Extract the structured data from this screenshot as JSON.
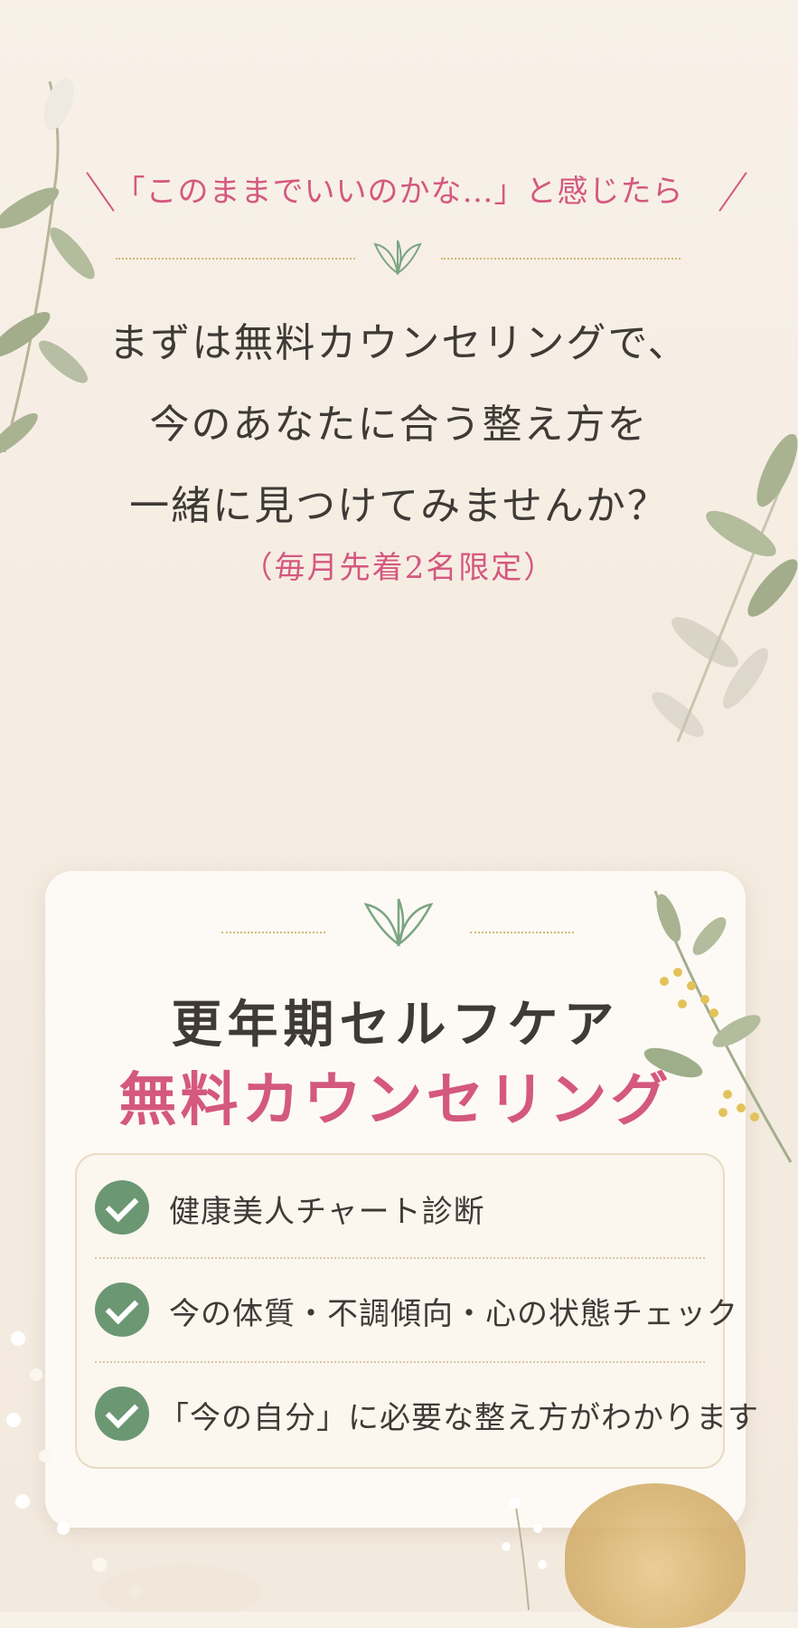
{
  "intro": {
    "lead_text": "「このままでいいのかな…」と感じたら",
    "lines": [
      "まずは無料カウンセリングで、",
      "今のあなたに合う整え方を",
      "一緒に見つけてみませんか？"
    ],
    "limited": "（毎月先着2名限定）"
  },
  "card": {
    "title": "更年期セルフケア",
    "subtitle": "無料カウンセリング",
    "items": [
      {
        "label": "健康美人チャート診断",
        "icon": "check-icon"
      },
      {
        "label": "今の体質・不調傾向・心の状態チェック",
        "icon": "check-icon"
      },
      {
        "label": "「今の自分」に必要な整え方がわかります",
        "icon": "check-icon"
      }
    ]
  },
  "colors": {
    "accent_pink": "#d4587f",
    "text_dark": "#3f3a36",
    "check_green": "#6b9773",
    "gold_dots": "#d2b774",
    "background": "#f6eee4"
  }
}
